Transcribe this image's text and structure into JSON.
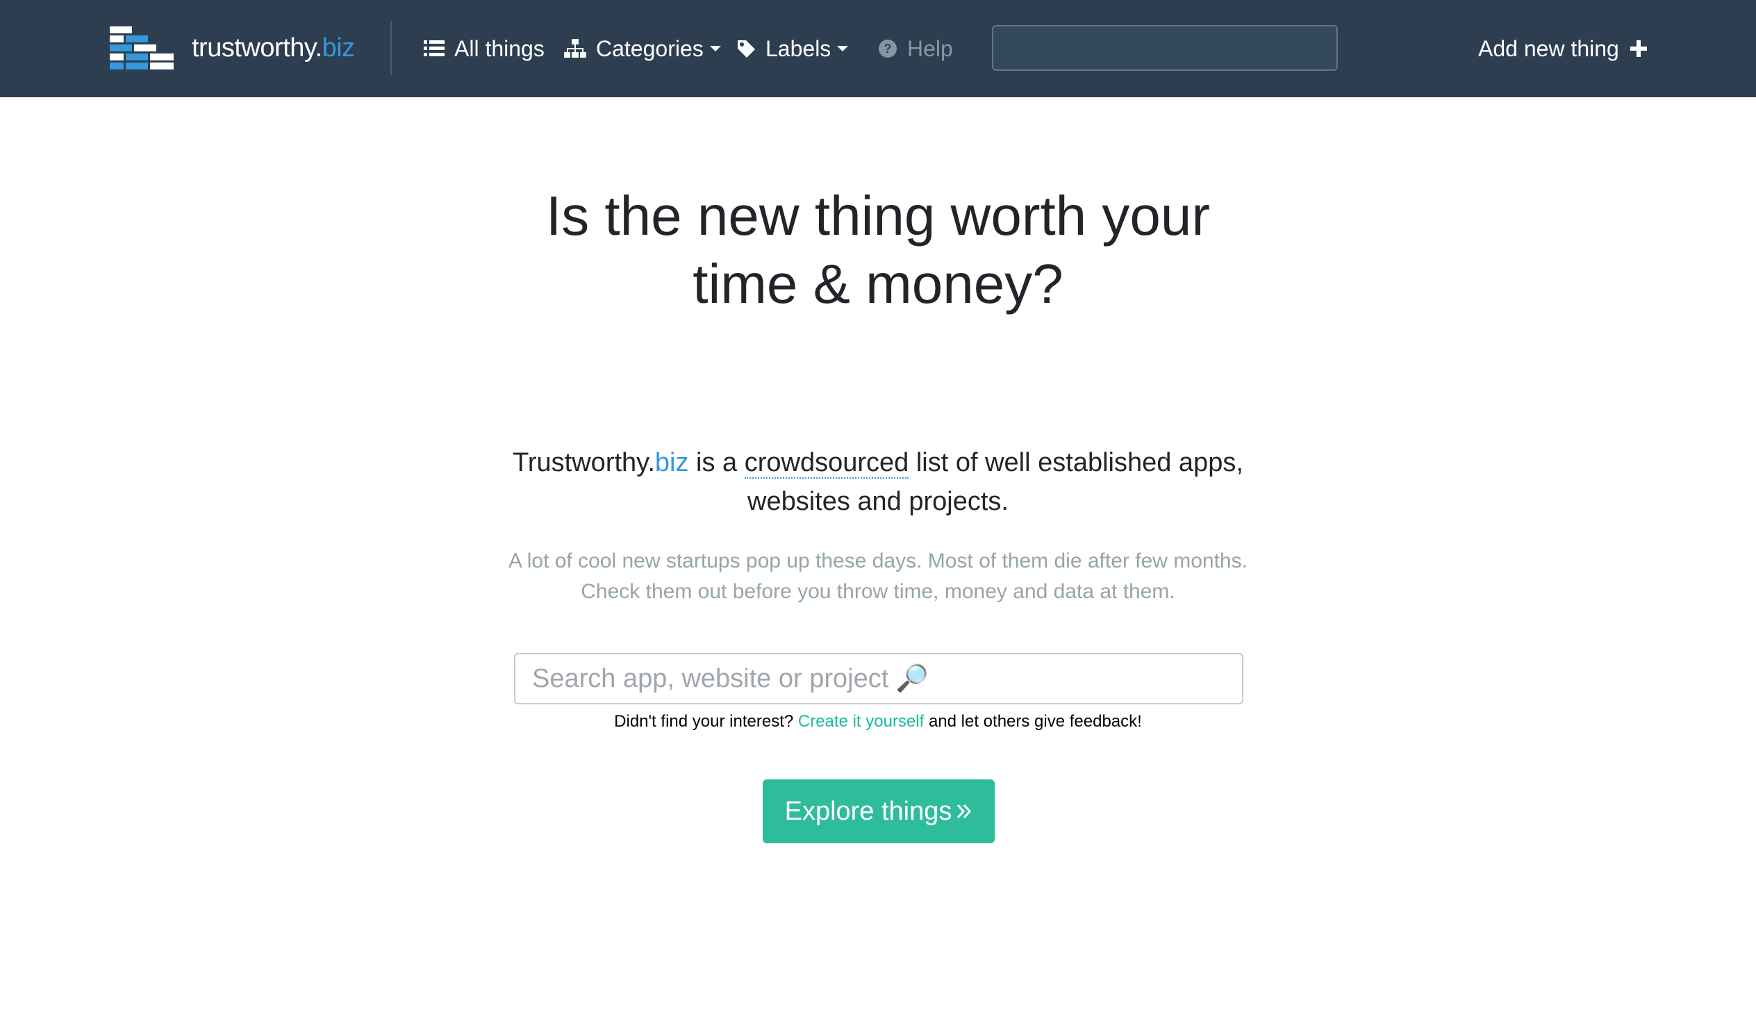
{
  "navbar": {
    "brand": {
      "text_main": "trustworthy.",
      "text_accent": "biz",
      "logo_icon": "bricks-logo-icon"
    },
    "items": [
      {
        "label": "All things",
        "icon": "list-icon"
      },
      {
        "label": "Categories",
        "icon": "sitemap-icon",
        "dropdown": true
      },
      {
        "label": "Labels",
        "icon": "tag-icon",
        "dropdown": true
      },
      {
        "label": "Help",
        "icon": "question-circle-icon",
        "disabled": true
      }
    ],
    "search": {
      "value": "",
      "placeholder": ""
    },
    "add_new": {
      "label": "Add new thing",
      "icon": "plus-icon"
    }
  },
  "hero": {
    "headline_line1": "Is the new thing worth your",
    "headline_line2": "time & money?",
    "lead": {
      "brand_main": "Trustworthy.",
      "brand_accent": "biz",
      "text_before_link": " is a ",
      "crowdsourced": "crowdsourced",
      "text_after_link": " list of well established apps,",
      "line2": "websites and projects."
    },
    "sub_line1": "A lot of cool new startups pop up these days. Most of them die after few months.",
    "sub_line2": "Check them out before you throw time, money and data at them.",
    "search_placeholder": "Search app, website or project 🔎",
    "hint": {
      "before": "Didn't find your interest? ",
      "link": "Create it yourself",
      "after": " and let others give feedback!"
    },
    "explore_button": "Explore things"
  },
  "colors": {
    "navbar_bg": "#2c3e50",
    "accent_blue": "#3498db",
    "accent_green": "#2ebd9c",
    "muted_text": "#95a5a6"
  }
}
